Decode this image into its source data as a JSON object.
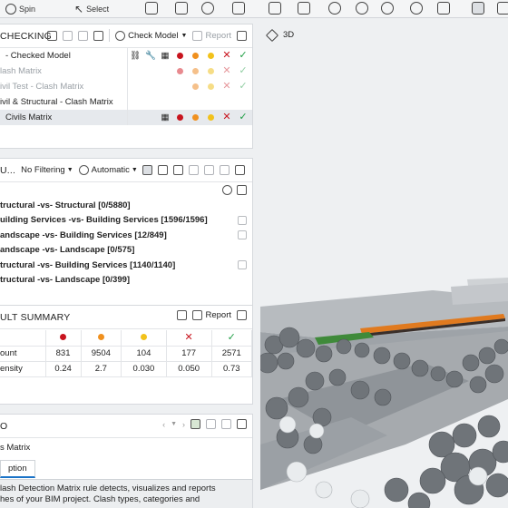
{
  "toolbar": {
    "spin_label": "Spin",
    "select_label": "Select"
  },
  "checking_panel": {
    "title": "CHECKING",
    "check_model_label": "Check Model",
    "report_label": "Report",
    "rows": [
      {
        "label": "- Checked Model"
      },
      {
        "label": "lash Matrix"
      },
      {
        "label": "ivil Test - Clash Matrix"
      },
      {
        "label": "ivil & Structural - Clash Matrix"
      },
      {
        "label": "Civils Matrix"
      }
    ]
  },
  "results_panel": {
    "group_label": "U...",
    "filter_label": "No Filtering",
    "automatic_label": "Automatic",
    "rows": [
      {
        "label": "tructural -vs- Structural [0/5880]"
      },
      {
        "label": "uilding Services -vs- Building Services [1596/1596]"
      },
      {
        "label": "andscape -vs- Building Services [12/849]"
      },
      {
        "label": "andscape -vs- Landscape [0/575]"
      },
      {
        "label": "tructural -vs- Building Services [1140/1140]"
      },
      {
        "label": "tructural -vs- Landscape [0/399]"
      }
    ]
  },
  "summary_panel": {
    "title": "ULT SUMMARY",
    "report_label": "Report",
    "rows": [
      {
        "label": "ount",
        "values": [
          "831",
          "9504",
          "104",
          "177",
          "2571"
        ]
      },
      {
        "label": "ensity",
        "values": [
          "0.24",
          "2.7",
          "0.030",
          "0.050",
          "0.73"
        ]
      }
    ]
  },
  "info_panel": {
    "title": "O",
    "subtitle": "s Matrix",
    "tab_label": "ption",
    "description_line1": "lash Detection Matrix rule detects, visualizes and reports",
    "description_line2": "hes of your BIM project. Clash types, categories and"
  },
  "viewport": {
    "view_mode_label": "3D"
  },
  "colors": {
    "critical": "#c8141e",
    "major": "#f0901e",
    "minor": "#f2c21b",
    "accepted": "#c8141e",
    "resolved": "#1f9e44",
    "accent": "#1a73c7"
  }
}
